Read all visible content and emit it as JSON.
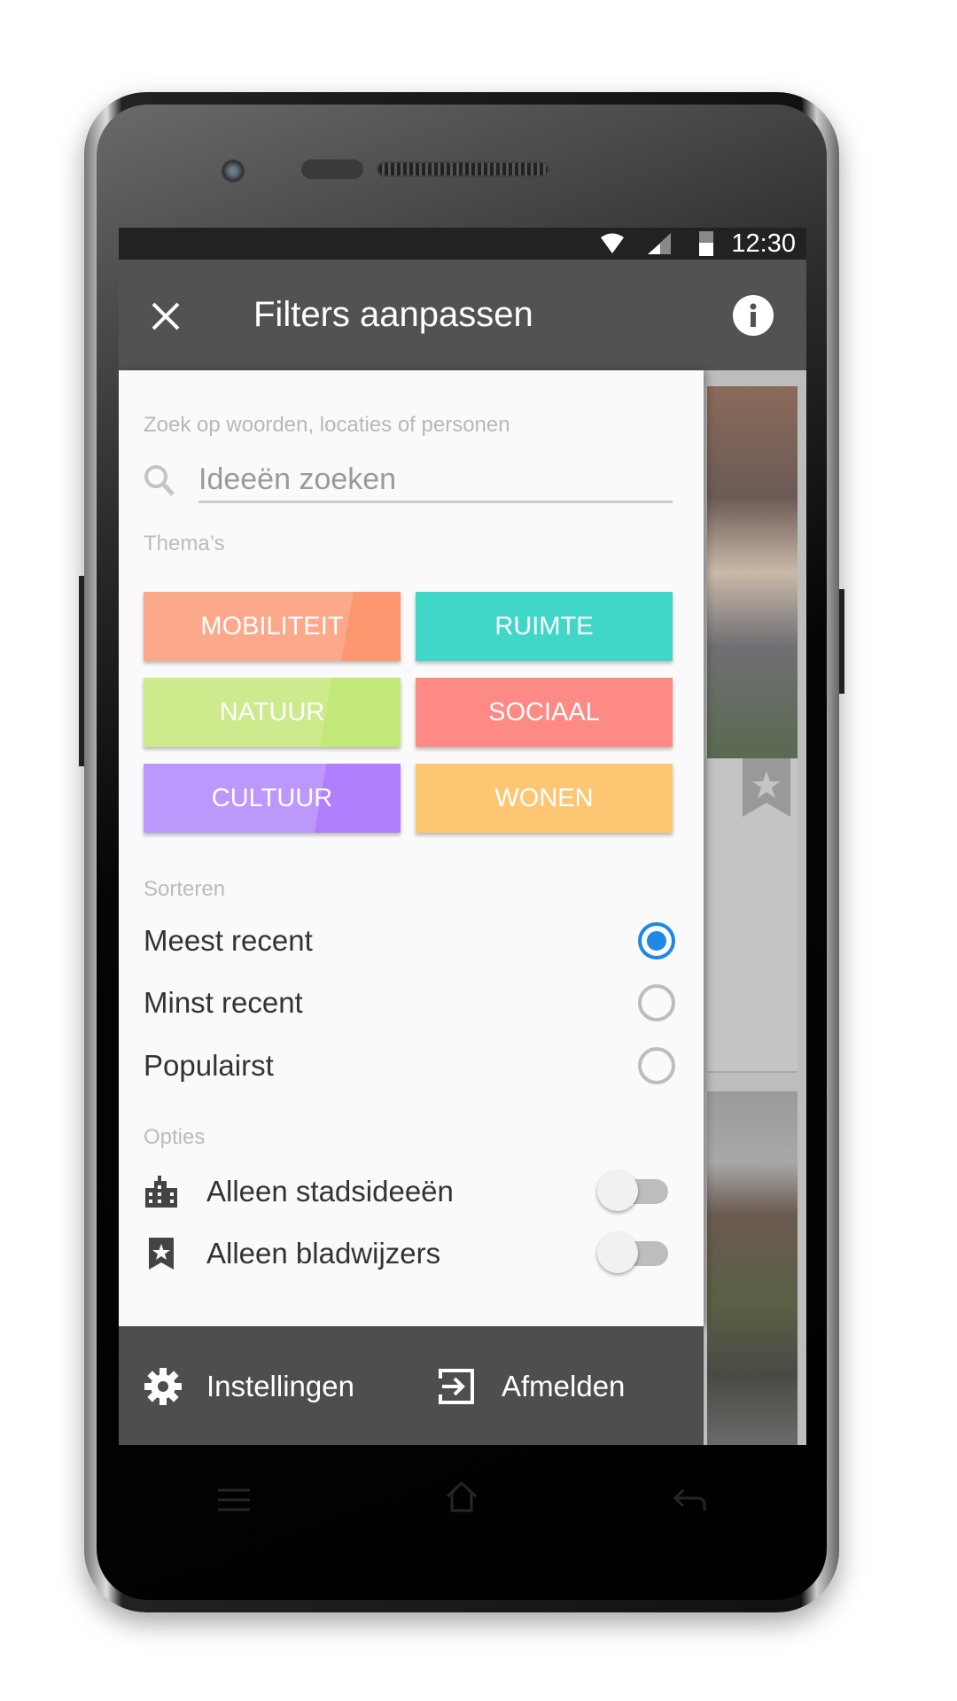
{
  "status_bar": {
    "time": "12:30"
  },
  "app_bar": {
    "title": "Filters aanpassen",
    "close_icon": "close-icon",
    "info_icon": "info-icon"
  },
  "search": {
    "hint": "Zoek op woorden, locaties of personen",
    "placeholder": "Ideeën zoeken",
    "value": ""
  },
  "themes": {
    "label": "Thema’s",
    "items": [
      {
        "label": "MOBILITEIT",
        "color": "#fba98a"
      },
      {
        "label": "RUIMTE",
        "color": "#40d7c9"
      },
      {
        "label": "NATUUR",
        "color": "#c8e87e"
      },
      {
        "label": "SOCIAAL",
        "color": "#fd8a84"
      },
      {
        "label": "CULTUUR",
        "color": "#b58cfd"
      },
      {
        "label": "WONEN",
        "color": "#fdc673"
      }
    ]
  },
  "sort": {
    "label": "Sorteren",
    "options": [
      {
        "label": "Meest recent",
        "selected": true
      },
      {
        "label": "Minst recent",
        "selected": false
      },
      {
        "label": "Populairst",
        "selected": false
      }
    ]
  },
  "options": {
    "label": "Opties",
    "items": [
      {
        "label": "Alleen stadsideeën",
        "icon": "city-icon",
        "enabled": false
      },
      {
        "label": "Alleen bladwijzers",
        "icon": "bookmark-icon",
        "enabled": false
      }
    ]
  },
  "bottom": {
    "settings": "Instellingen",
    "logout": "Afmelden"
  },
  "accent": "#1e88e5"
}
